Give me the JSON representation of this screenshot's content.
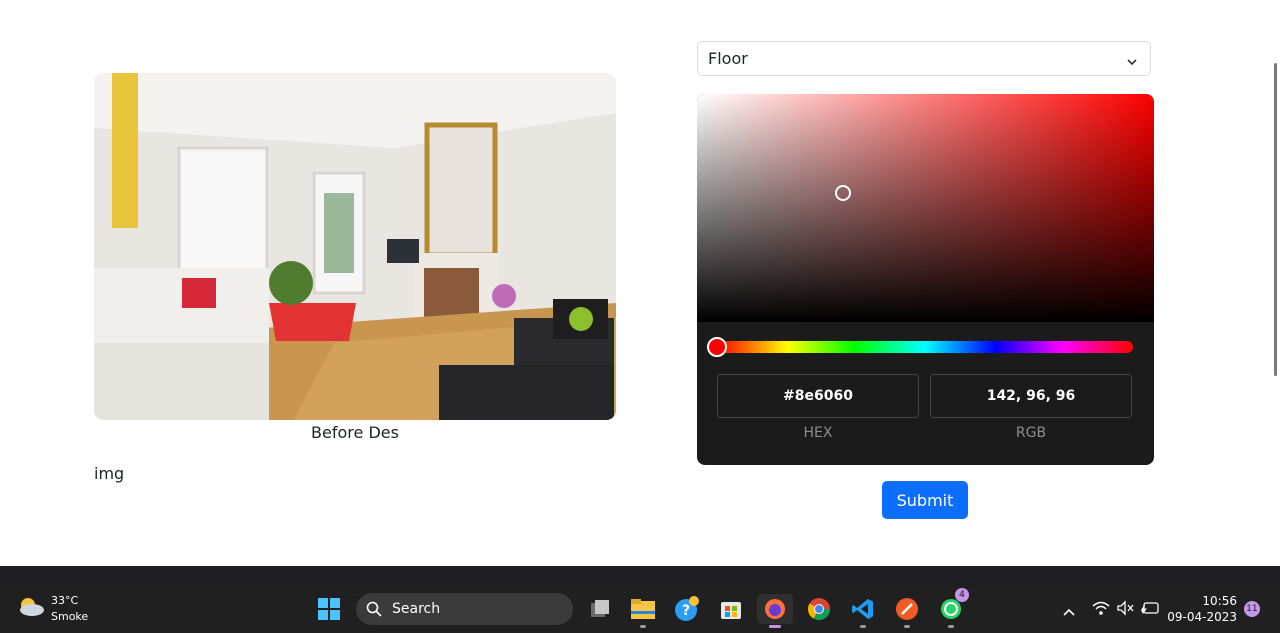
{
  "photo": {
    "caption": "Before Des",
    "alt": "living room"
  },
  "img_label": "img",
  "surface_select": {
    "selected": "Floor"
  },
  "color_picker": {
    "hex_value": "#8e6060",
    "hex_label": "HEX",
    "rgb_value": "142, 96, 96",
    "rgb_label": "RGB",
    "hue_color": "#ff0000"
  },
  "submit_label": "Submit",
  "taskbar": {
    "weather_temp": "33°C",
    "weather_desc": "Smoke",
    "search_label": "Search",
    "whatsapp_badge": "4",
    "time": "10:56",
    "date": "09-04-2023",
    "notification_count": "11"
  }
}
